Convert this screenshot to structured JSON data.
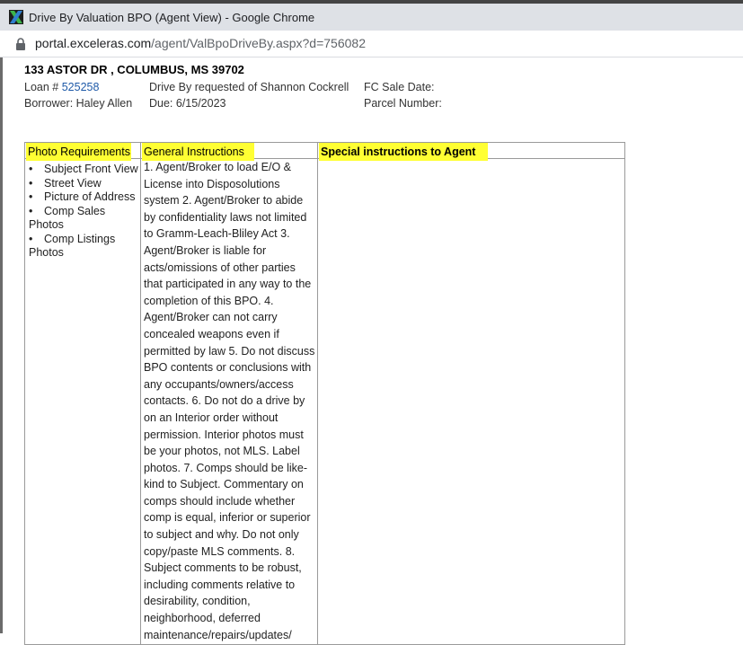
{
  "window": {
    "title": "Drive By Valuation BPO (Agent View) - Google Chrome",
    "url_host": "portal.exceleras.com",
    "url_path": "/agent/ValBpoDriveBy.aspx?d=756082"
  },
  "property": {
    "address": "133 ASTOR DR , COLUMBUS, MS 39702",
    "loan_label": "Loan #",
    "loan_number": "525258",
    "borrower": "Borrower: Haley Allen",
    "drive_by": "Drive By requested of Shannon Cockrell",
    "due": "Due: 6/15/2023",
    "fc_sale_date": "FC Sale Date:",
    "parcel_number": "Parcel Number:"
  },
  "table": {
    "photo_header": "Photo Requirements",
    "general_header": "General Instructions",
    "special_header": "Special instructions to Agent",
    "photo_items": [
      "Subject Front View",
      "Street View",
      "Picture of Address",
      "Comp Sales Photos",
      "Comp Listings Photos"
    ],
    "general_text": "1. Agent/Broker to load E/O & License into Disposolutions system 2. Agent/Broker to abide by confidentiality laws not limited to Gramm-Leach-Bliley Act 3. Agent/Broker is liable for acts/omissions of other parties that participated in any way to the completion of this BPO. 4. Agent/Broker can not carry concealed weapons even if permitted by law 5. Do not discuss BPO contents or conclusions with any occupants/owners/access contacts. 6. Do not do a drive by on an Interior order without permission. Interior photos must be your photos, not MLS. Label photos. 7. Comps should be like-kind to Subject. Commentary on comps should include whether comp is equal, inferior or superior to subject and why. Do not only copy/paste MLS comments. 8. Subject comments to be robust, including comments relative to desirability, condition, neighborhood, deferred maintenance/repairs/updates/"
  }
}
